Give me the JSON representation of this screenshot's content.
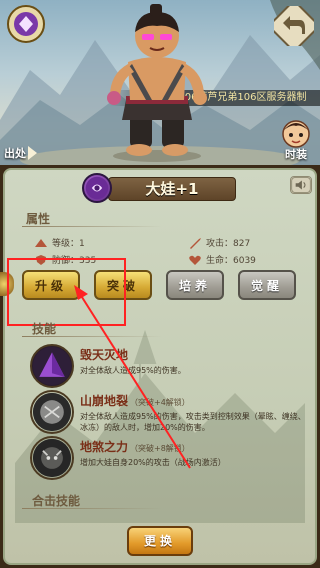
{
  "scene": {
    "ticker_text": "S106葫芦兄弟106区服务器制",
    "exit_label": "出处",
    "fashion_label": "时装"
  },
  "character": {
    "name": "大娃+1"
  },
  "attributes": {
    "section_title": "属性",
    "level_label": "等级：1",
    "attack_label": "攻击：827",
    "defense_label": "防御：335",
    "hp_label": "生命：6039"
  },
  "actions": {
    "upgrade": "升级",
    "breakthrough": "突破",
    "train": "培养",
    "awaken": "觉醒"
  },
  "skills": {
    "section_title": "技能",
    "items": [
      {
        "name": "毁天灭地",
        "sub": "",
        "desc": "对全体敌人造成95%的伤害。"
      },
      {
        "name": "山崩地裂",
        "sub": "（突破+4解锁）",
        "desc": "对全体敌人造成95%的伤害，攻击类到控制效果（晕眩、缠绕、冰冻）的敌人时，增加20%的伤害。"
      },
      {
        "name": "地煞之力",
        "sub": "（突破+8解锁）",
        "desc": "增加大娃自身20%的攻击（战场内激活）"
      }
    ]
  },
  "combo": {
    "section_title": "合击技能"
  },
  "footer": {
    "swap_label": "更换"
  },
  "colors": {
    "highlight": "#ff2222",
    "gold_button": "#d5a934",
    "grey_button": "#9f9c93"
  }
}
